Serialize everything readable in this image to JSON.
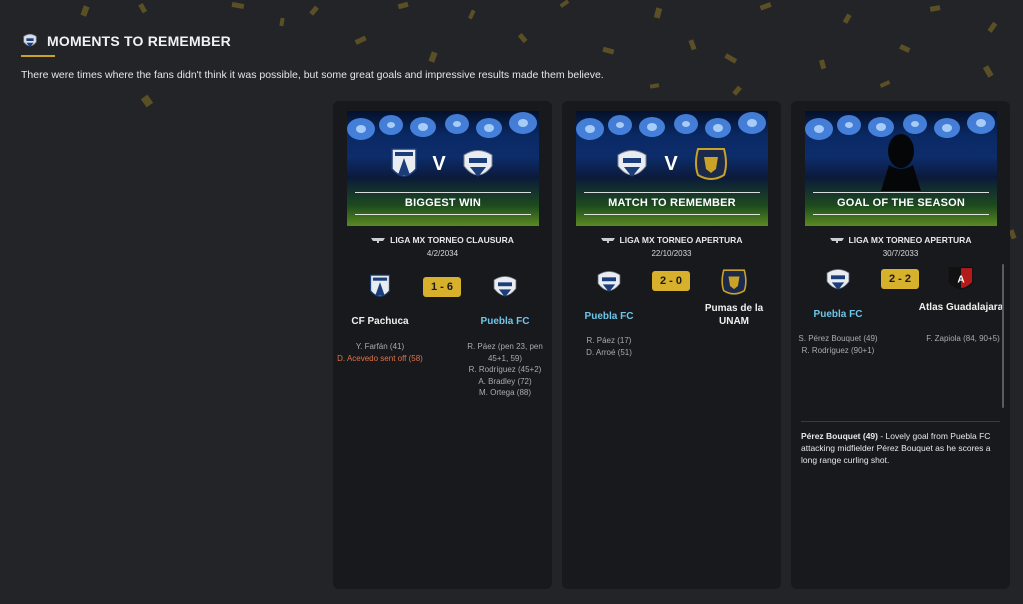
{
  "header": {
    "title": "MOMENTS TO REMEMBER",
    "subtitle": "There were times where the fans didn't think it was possible, but some great goals and impressive results made them believe."
  },
  "colors": {
    "background": "#232428",
    "card": "#18191c",
    "score_badge": "#d8b12c",
    "highlight_team": "#6ec6e8",
    "sent_off": "#e0724a",
    "confetti": "#a88a2a"
  },
  "cards": [
    {
      "label": "BIGGEST WIN",
      "banner_v": "V",
      "competition": "LIGA MX TORNEO CLAUSURA",
      "date": "4/2/2034",
      "score": "1 - 6",
      "home": {
        "name": "CF Pachuca",
        "crest_icon": "pachuca-crest-icon"
      },
      "away": {
        "name": "Puebla FC",
        "crest_icon": "puebla-crest-icon"
      },
      "home_scorers": [
        "Y. Farfán (41)"
      ],
      "home_sent_off": "D. Acevedo sent off (58)",
      "away_scorers": [
        "R. Páez (pen 23, pen 45+1, 59)",
        "R. Rodríguez (45+2)",
        "A. Bradley (72)",
        "M. Ortega (88)"
      ]
    },
    {
      "label": "MATCH TO REMEMBER",
      "banner_v": "V",
      "competition": "LIGA MX TORNEO APERTURA",
      "date": "22/10/2033",
      "score": "2 - 0",
      "home": {
        "name": "Puebla FC",
        "crest_icon": "puebla-crest-icon"
      },
      "away": {
        "name": "Pumas de la UNAM",
        "crest_icon": "pumas-crest-icon"
      },
      "home_scorers": [
        "R. Páez (17)",
        "D. Arroé (51)"
      ],
      "away_scorers": []
    },
    {
      "label": "GOAL OF THE SEASON",
      "competition": "LIGA MX TORNEO APERTURA",
      "date": "30/7/2033",
      "score": "2 - 2",
      "home": {
        "name": "Puebla FC",
        "crest_icon": "puebla-crest-icon"
      },
      "away": {
        "name": "Atlas Guadalajara",
        "crest_icon": "atlas-crest-icon"
      },
      "home_scorers": [
        "S. Pérez Bouquet (49)",
        "R. Rodríguez (90+1)"
      ],
      "away_scorers": [
        "F. Zapiola (84, 90+5)"
      ],
      "goal_player": "Pérez Bouquet (49)",
      "goal_description": " - Lovely goal from Puebla FC attacking midfielder Pérez Bouquet as he scores a long range curling shot."
    }
  ]
}
